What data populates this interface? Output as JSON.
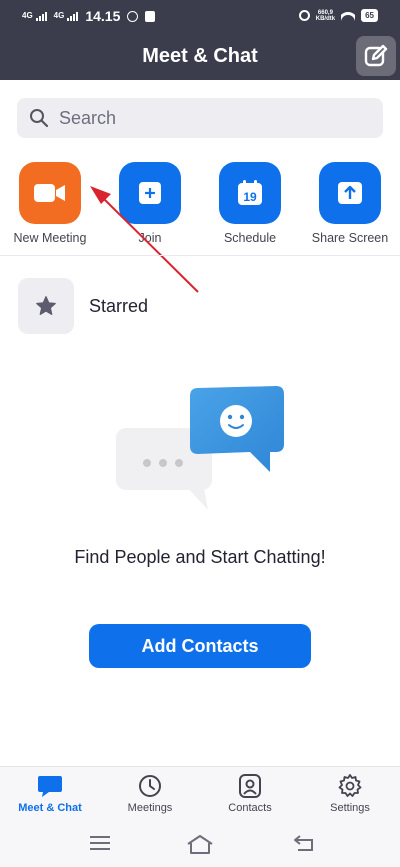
{
  "status_bar": {
    "signal_1": "4G",
    "signal_2": "4G",
    "time": "14.15",
    "speed": "660,9",
    "speed_unit": "KB/dtk",
    "battery": "65"
  },
  "header": {
    "title": "Meet & Chat",
    "compose_icon": "compose-icon"
  },
  "search": {
    "placeholder": "Search"
  },
  "actions": [
    {
      "label": "New Meeting",
      "icon": "video-camera-icon",
      "color": "#f26d21"
    },
    {
      "label": "Join",
      "icon": "plus-icon",
      "color": "#0e71eb"
    },
    {
      "label": "Schedule",
      "icon": "calendar-icon",
      "color": "#0e71eb",
      "calendar_day": "19"
    },
    {
      "label": "Share Screen",
      "icon": "share-screen-icon",
      "color": "#0e71eb"
    }
  ],
  "starred": {
    "label": "Starred",
    "icon": "star-icon"
  },
  "empty_state": {
    "message": "Find People and Start Chatting!"
  },
  "add_contacts": {
    "label": "Add Contacts"
  },
  "tabs": [
    {
      "label": "Meet & Chat",
      "icon": "chat-bubble-icon",
      "active": true
    },
    {
      "label": "Meetings",
      "icon": "clock-icon",
      "active": false
    },
    {
      "label": "Contacts",
      "icon": "contact-icon",
      "active": false
    },
    {
      "label": "Settings",
      "icon": "gear-icon",
      "active": false
    }
  ],
  "colors": {
    "header_bg": "#3b3c4c",
    "accent_blue": "#0e71eb",
    "accent_orange": "#f26d21",
    "annotation_arrow": "#d9232d"
  }
}
